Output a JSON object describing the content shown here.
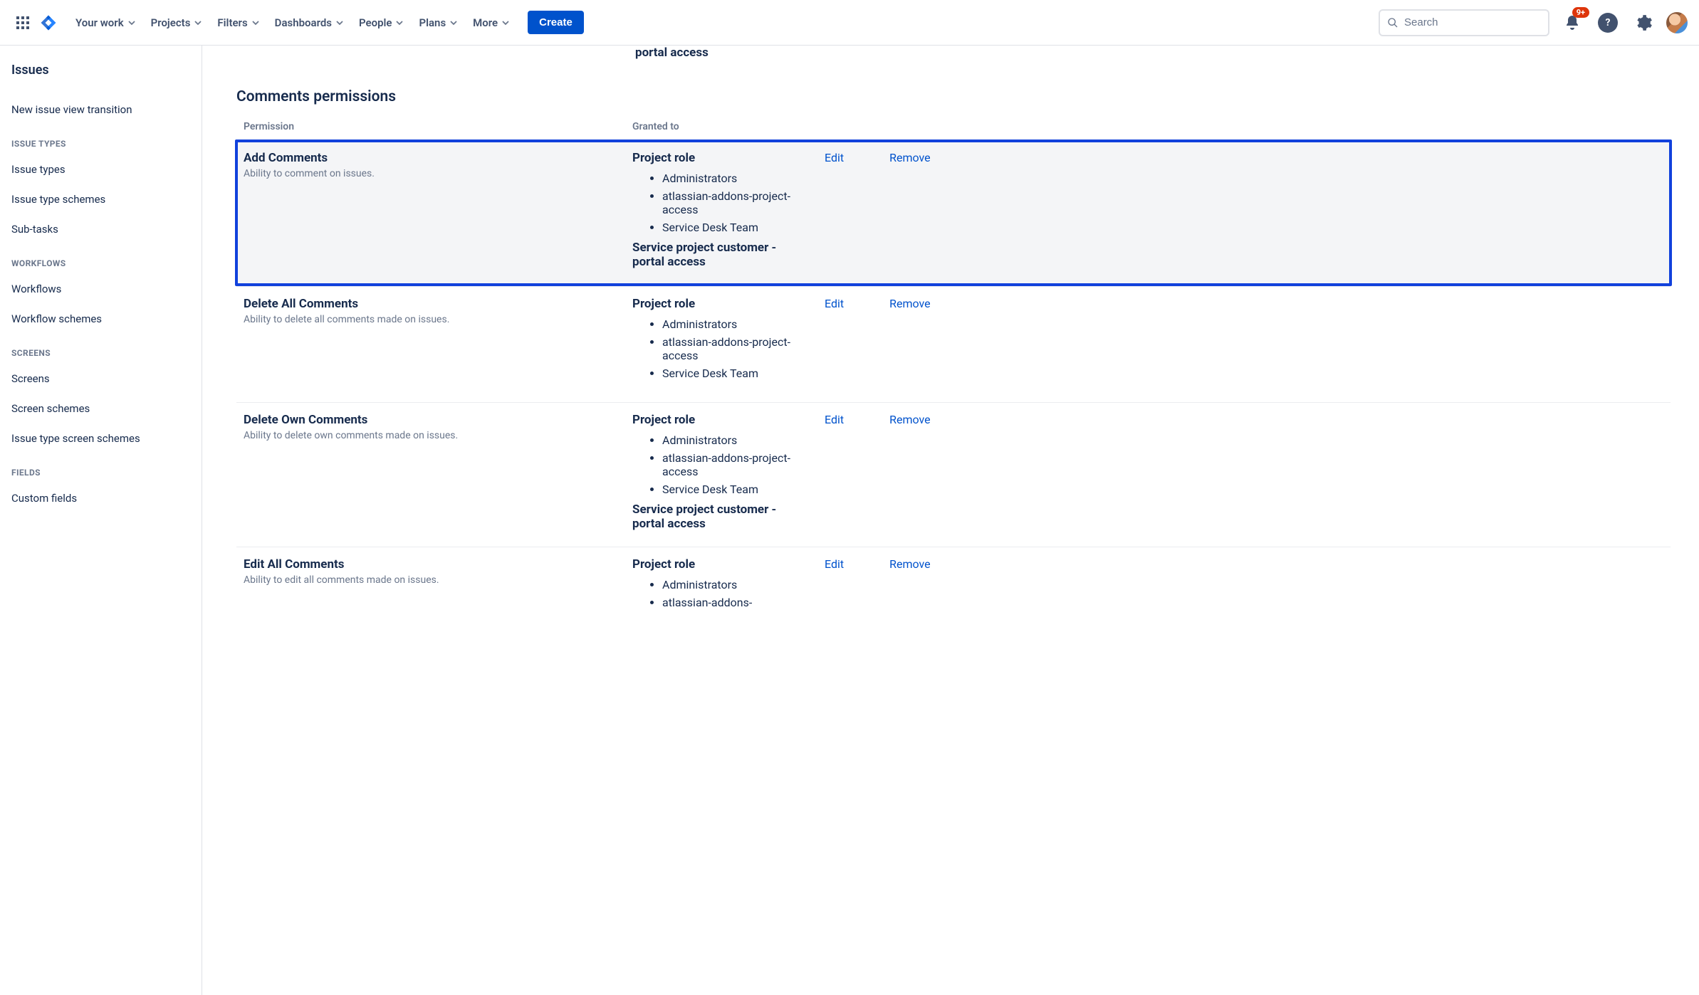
{
  "nav": {
    "items": [
      "Your work",
      "Projects",
      "Filters",
      "Dashboards",
      "People",
      "Plans",
      "More"
    ],
    "create": "Create",
    "search_placeholder": "Search",
    "notif_badge": "9+"
  },
  "sidebar": {
    "title": "Issues",
    "top_link": "New issue view transition",
    "groups": [
      {
        "label": "ISSUE TYPES",
        "items": [
          "Issue types",
          "Issue type schemes",
          "Sub-tasks"
        ]
      },
      {
        "label": "WORKFLOWS",
        "items": [
          "Workflows",
          "Workflow schemes"
        ]
      },
      {
        "label": "SCREENS",
        "items": [
          "Screens",
          "Screen schemes",
          "Issue type screen schemes"
        ]
      },
      {
        "label": "FIELDS",
        "items": [
          "Custom fields"
        ]
      }
    ]
  },
  "main": {
    "cutoff_text": "portal access",
    "section_title": "Comments permissions",
    "head_permission": "Permission",
    "head_granted": "Granted to",
    "edit_label": "Edit",
    "remove_label": "Remove",
    "project_role_label": "Project role",
    "extra_grant_label": "Service project customer - portal access",
    "roles": [
      "Administrators",
      "atlassian-addons-project-access",
      "Service Desk Team"
    ],
    "rows": [
      {
        "name": "Add Comments",
        "desc": "Ability to comment on issues.",
        "extra": true,
        "highlight": true
      },
      {
        "name": "Delete All Comments",
        "desc": "Ability to delete all comments made on issues.",
        "extra": false,
        "highlight": false
      },
      {
        "name": "Delete Own Comments",
        "desc": "Ability to delete own comments made on issues.",
        "extra": true,
        "highlight": false
      },
      {
        "name": "Edit All Comments",
        "desc": "Ability to edit all comments made on issues.",
        "extra": false,
        "highlight": false
      }
    ],
    "last_row_partial_roles": [
      "Administrators",
      "atlassian-addons-"
    ]
  }
}
